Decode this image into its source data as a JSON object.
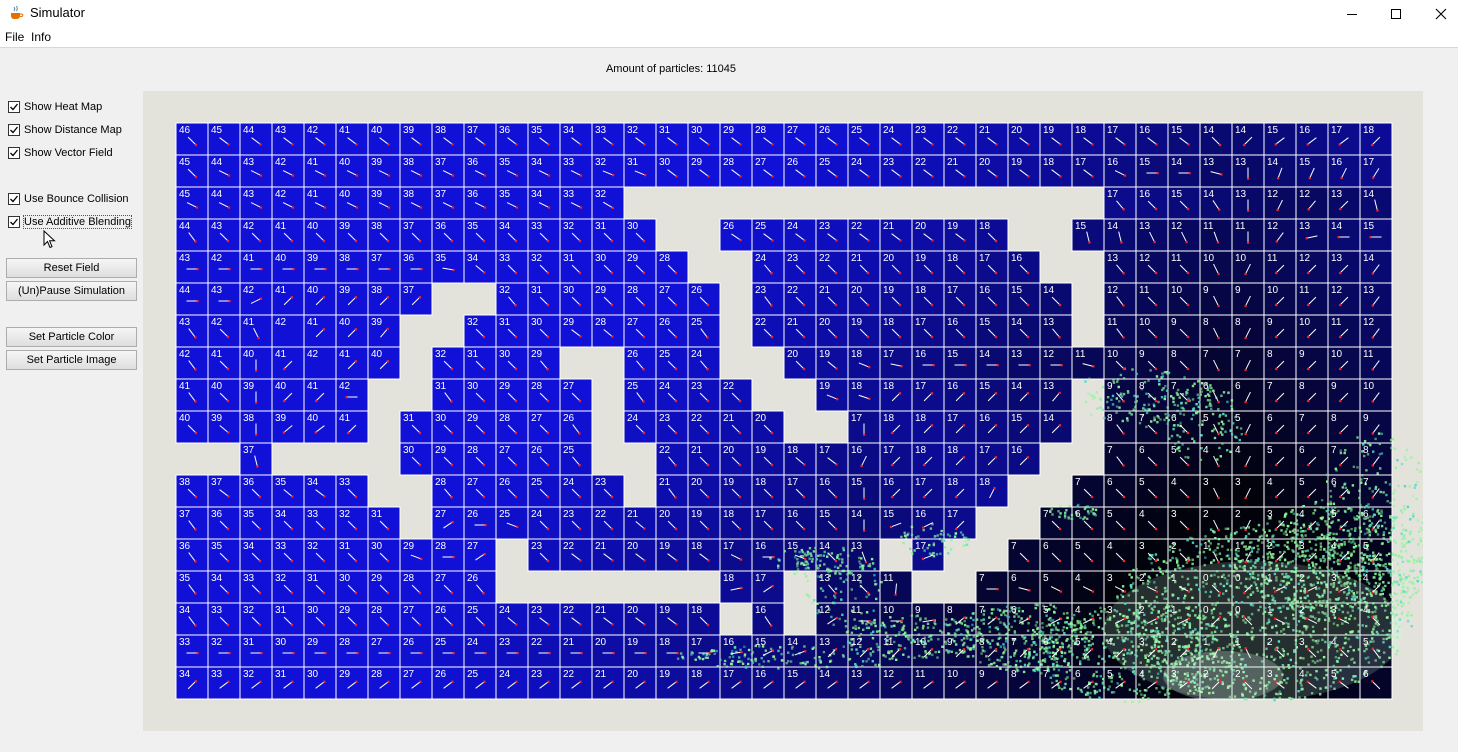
{
  "window": {
    "title": "Simulator",
    "app_icon": "java-cup-icon",
    "controls": [
      "minimize-icon",
      "maximize-icon",
      "close-icon"
    ]
  },
  "menu": {
    "items": [
      "File",
      "Info"
    ]
  },
  "status": {
    "label": "Amount of particles: 11045"
  },
  "controls": {
    "checkboxes": [
      {
        "label": "Show Heat Map",
        "checked": true
      },
      {
        "label": "Show Distance Map",
        "checked": true
      },
      {
        "label": "Show Vector Field",
        "checked": true
      },
      {
        "label": "Use Bounce Collision",
        "checked": true
      },
      {
        "label": "Use Additive Blending",
        "checked": true
      }
    ],
    "buttons": [
      "Reset Field",
      "(Un)Pause Simulation",
      "Set Particle Color",
      "Set Particle Image"
    ]
  },
  "colors": {
    "heat_near": "#1010d6",
    "heat_far": "#02020c",
    "wall": "#e3e3dc",
    "grid_line": "#ffffff",
    "vector_head": "#ff2222",
    "particle_a": "#8df59a",
    "particle_b": "#4ad8c8"
  },
  "grid": {
    "cols": 38,
    "rows": 18,
    "distance_map": [
      "46 45 44 43 42 41 40 39 38 37 36 35 34 33 32 31 30 29 28 27 26 25 24 23 22 21 20 19 18 17 16 15 14 14 15 16 17 18",
      "45 44 43 42 41 40 39 38 37 36 35 34 33 32 31 30 29 28 27 26 25 24 23 22 21 20 19 18 17 16 15 14 13 13 14 15 16 17",
      "45 44 43 42 41 40 39 38 37 36 35 34 33 32 . . . . . . . . . . . . . . . 17 16 15 14 13 12 12 13 14 15 16",
      "44 43 42 41 40 39 38 37 36 35 34 33 32 31 30 . . 26 25 24 23 22 21 20 19 18 . . 15 14 13 12 11 11 12 13 14 15",
      "43 42 41 40 39 38 37 36 35 34 33 32 31 30 29 28 . . 24 23 22 21 20 19 18 17 16 . . 13 12 11 10 10 11 12 13 14",
      "44 43 42 41 40 39 38 37 . . 32 31 30 29 28 27 26 . 23 22 21 20 19 18 17 16 15 14 . 12 11 10 9 9 10 11 12 13",
      "43 42 41 42 41 40 39 . . 32 31 30 29 28 27 26 25 . 22 21 20 19 18 17 16 15 14 13 . 11 10 9 8 8 9 10 11 12",
      "42 41 40 41 42 41 40 . 32 31 30 29 . . 26 25 24 . . 20 19 18 17 16 15 14 13 12 11 10 9 8 7 7 8 9 10 11",
      "41 40 39 40 41 42 . . 31 30 29 28 27 . 25 24 23 22 . . 19 18 18 17 16 15 14 13 . 9 8 7 6 6 7 8 9 10",
      "40 39 38 39 40 41 . 31 30 29 28 27 26 . 24 23 22 21 20 . . 17 18 18 17 16 15 14 . 8 7 6 5 5 6 7 8 9",
      ". . 37 . . . . 30 29 28 27 26 25 . . 22 21 20 19 18 17 16 17 18 18 17 16 . . 7 6 5 4 4 5 6 7 8",
      "38 37 36 35 34 33 . . 28 27 26 25 24 23 . 21 20 19 18 17 16 15 16 17 18 18 . . 7 6 5 4 3 3 4 5 6 7",
      "37 36 35 34 33 32 31 . 27 26 25 24 23 22 21 20 19 18 17 16 15 14 15 16 17 . . 7 6 5 4 3 2 2 3 4 5 6",
      "36 35 34 33 32 31 30 29 28 27 . 23 22 21 20 19 18 17 16 15 14 13 . 17 . . 7 6 5 4 3 2 1 1 2 3 4 5",
      "35 34 33 32 31 30 29 28 27 26 . . . . . . . 18 17 . 13 12 11 . . 7 6 5 4 3 2 1 0 0 1 2 3 4",
      "34 33 32 31 30 29 28 27 26 25 24 23 22 21 20 19 18 . 16 . 12 11 10 9 8 7 6 5 4 3 2 1 0 0 1 2 3 4",
      "33 32 31 30 29 28 27 26 25 24 23 22 21 20 19 18 17 16 15 14 13 12 11 10 9 8 7 6 5 4 3 2 1 1 2 3 4 5",
      "34 33 32 31 30 29 28 27 26 25 24 23 22 21 20 19 18 17 16 15 14 13 12 11 10 9 8 7 6 5 4 3 2 2 3 4 5 6"
    ]
  }
}
